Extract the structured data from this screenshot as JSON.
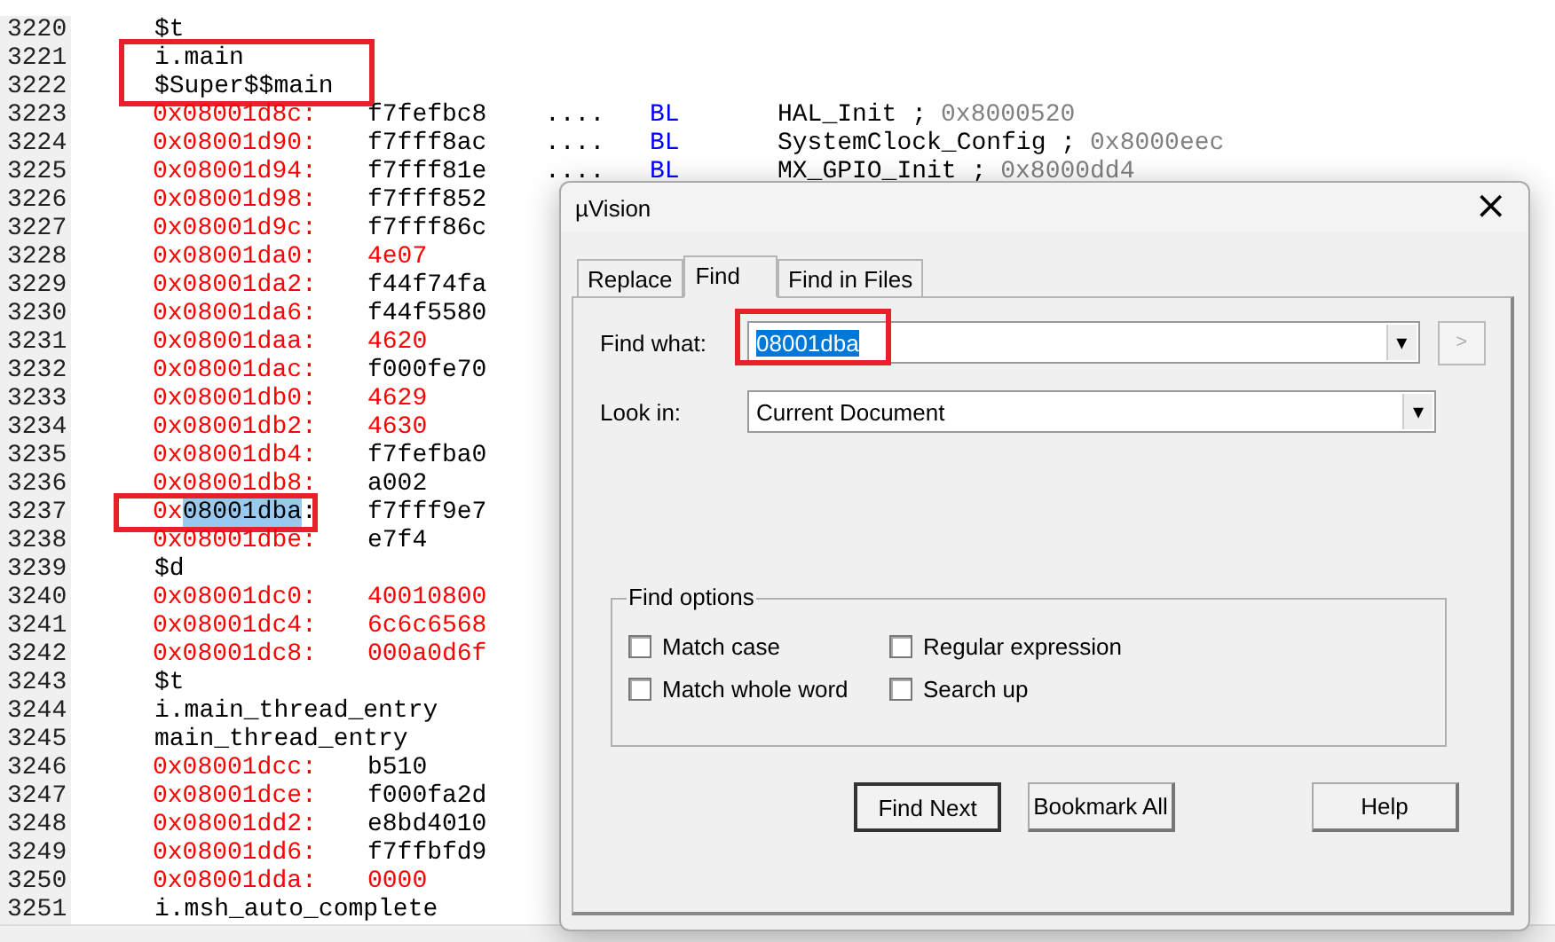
{
  "editor": {
    "rows": [
      {
        "line": "3220",
        "kind": "label",
        "text": "$t"
      },
      {
        "line": "3221",
        "kind": "label",
        "text": "i.main",
        "outlined": true
      },
      {
        "line": "3222",
        "kind": "label",
        "text": "$Super$$main",
        "outlined": true
      },
      {
        "line": "3223",
        "kind": "code",
        "address": "0x08001d8c:",
        "hex": "f7fefbc8",
        "is_literal": false,
        "dots": "....",
        "mnemonic": "BL",
        "operand": "HAL_Init ;",
        "comment": "0x8000520"
      },
      {
        "line": "3224",
        "kind": "code",
        "address": "0x08001d90:",
        "hex": "f7fff8ac",
        "is_literal": false,
        "dots": "....",
        "mnemonic": "BL",
        "operand": "SystemClock_Config ;",
        "comment": "0x8000eec"
      },
      {
        "line": "3225",
        "kind": "code",
        "address": "0x08001d94:",
        "hex": "f7fff81e",
        "is_literal": false,
        "dots": "....",
        "mnemonic": "BL",
        "operand": "MX_GPIO_Init ;",
        "comment": "0x8000dd4"
      },
      {
        "line": "3226",
        "kind": "code",
        "address": "0x08001d98:",
        "hex": "f7fff852",
        "is_literal": false
      },
      {
        "line": "3227",
        "kind": "code",
        "address": "0x08001d9c:",
        "hex": "f7fff86c",
        "is_literal": false
      },
      {
        "line": "3228",
        "kind": "code",
        "address": "0x08001da0:",
        "hex": "4e07",
        "is_literal": true
      },
      {
        "line": "3229",
        "kind": "code",
        "address": "0x08001da2:",
        "hex": "f44f74fa",
        "is_literal": false
      },
      {
        "line": "3230",
        "kind": "code",
        "address": "0x08001da6:",
        "hex": "f44f5580",
        "is_literal": false
      },
      {
        "line": "3231",
        "kind": "code",
        "address": "0x08001daa:",
        "hex": "4620",
        "is_literal": true
      },
      {
        "line": "3232",
        "kind": "code",
        "address": "0x08001dac:",
        "hex": "f000fe70",
        "is_literal": false
      },
      {
        "line": "3233",
        "kind": "code",
        "address": "0x08001db0:",
        "hex": "4629",
        "is_literal": true
      },
      {
        "line": "3234",
        "kind": "code",
        "address": "0x08001db2:",
        "hex": "4630",
        "is_literal": true
      },
      {
        "line": "3235",
        "kind": "code",
        "address": "0x08001db4:",
        "hex": "f7fefba0",
        "is_literal": false
      },
      {
        "line": "3236",
        "kind": "code",
        "address": "0x08001db8:",
        "hex": "a002",
        "is_literal": false
      },
      {
        "line": "3237",
        "kind": "code",
        "address": "0x",
        "selected_text": "08001dba",
        "address_end": ":",
        "outlined": true,
        "hex": "f7fff9e7",
        "is_literal": false
      },
      {
        "line": "3238",
        "kind": "code",
        "address": "0x08001dbe:",
        "hex": "e7f4",
        "is_literal": false
      },
      {
        "line": "3239",
        "kind": "label",
        "text": "$d"
      },
      {
        "line": "3240",
        "kind": "code",
        "address": "0x08001dc0:",
        "hex": "40010800",
        "is_literal": true
      },
      {
        "line": "3241",
        "kind": "code",
        "address": "0x08001dc4:",
        "hex": "6c6c6568",
        "is_literal": true
      },
      {
        "line": "3242",
        "kind": "code",
        "address": "0x08001dc8:",
        "hex": "000a0d6f",
        "is_literal": true
      },
      {
        "line": "3243",
        "kind": "label",
        "text": "$t"
      },
      {
        "line": "3244",
        "kind": "label",
        "text": "i.main_thread_entry"
      },
      {
        "line": "3245",
        "kind": "label",
        "text": "main_thread_entry"
      },
      {
        "line": "3246",
        "kind": "code",
        "address": "0x08001dcc:",
        "hex": "b510",
        "is_literal": false
      },
      {
        "line": "3247",
        "kind": "code",
        "address": "0x08001dce:",
        "hex": "f000fa2d",
        "is_literal": false
      },
      {
        "line": "3248",
        "kind": "code",
        "address": "0x08001dd2:",
        "hex": "e8bd4010",
        "is_literal": false
      },
      {
        "line": "3249",
        "kind": "code",
        "address": "0x08001dd6:",
        "hex": "f7ffbfd9",
        "is_literal": false
      },
      {
        "line": "3250",
        "kind": "code",
        "address": "0x08001dda:",
        "hex": "0000",
        "is_literal": true
      },
      {
        "line": "3251",
        "kind": "label",
        "text": "i.msh_auto_complete"
      }
    ]
  },
  "dialog": {
    "title": "µVision",
    "close": "×",
    "tabs": [
      {
        "label": "Replace",
        "selected": false
      },
      {
        "label": "Find",
        "selected": true
      },
      {
        "label": "Find in Files",
        "selected": false
      }
    ],
    "find_what": {
      "label": "Find what:",
      "value": "08001dba",
      "value_selected": true,
      "outlined": true,
      "dropdown": "▾",
      "arrow_button": ">"
    },
    "look_in": {
      "label": "Look in:",
      "value": "Current Document",
      "dropdown": "▾"
    },
    "options": {
      "title": "Find options",
      "items": [
        {
          "label": "Match case",
          "checked": false
        },
        {
          "label": "Regular expression",
          "checked": false
        },
        {
          "label": "Match whole word",
          "checked": false
        },
        {
          "label": "Search up",
          "checked": false
        }
      ]
    },
    "buttons": [
      {
        "label": "Find Next",
        "default": true
      },
      {
        "label": "Bookmark All",
        "default": false
      },
      {
        "label": "Help",
        "default": false
      }
    ]
  }
}
